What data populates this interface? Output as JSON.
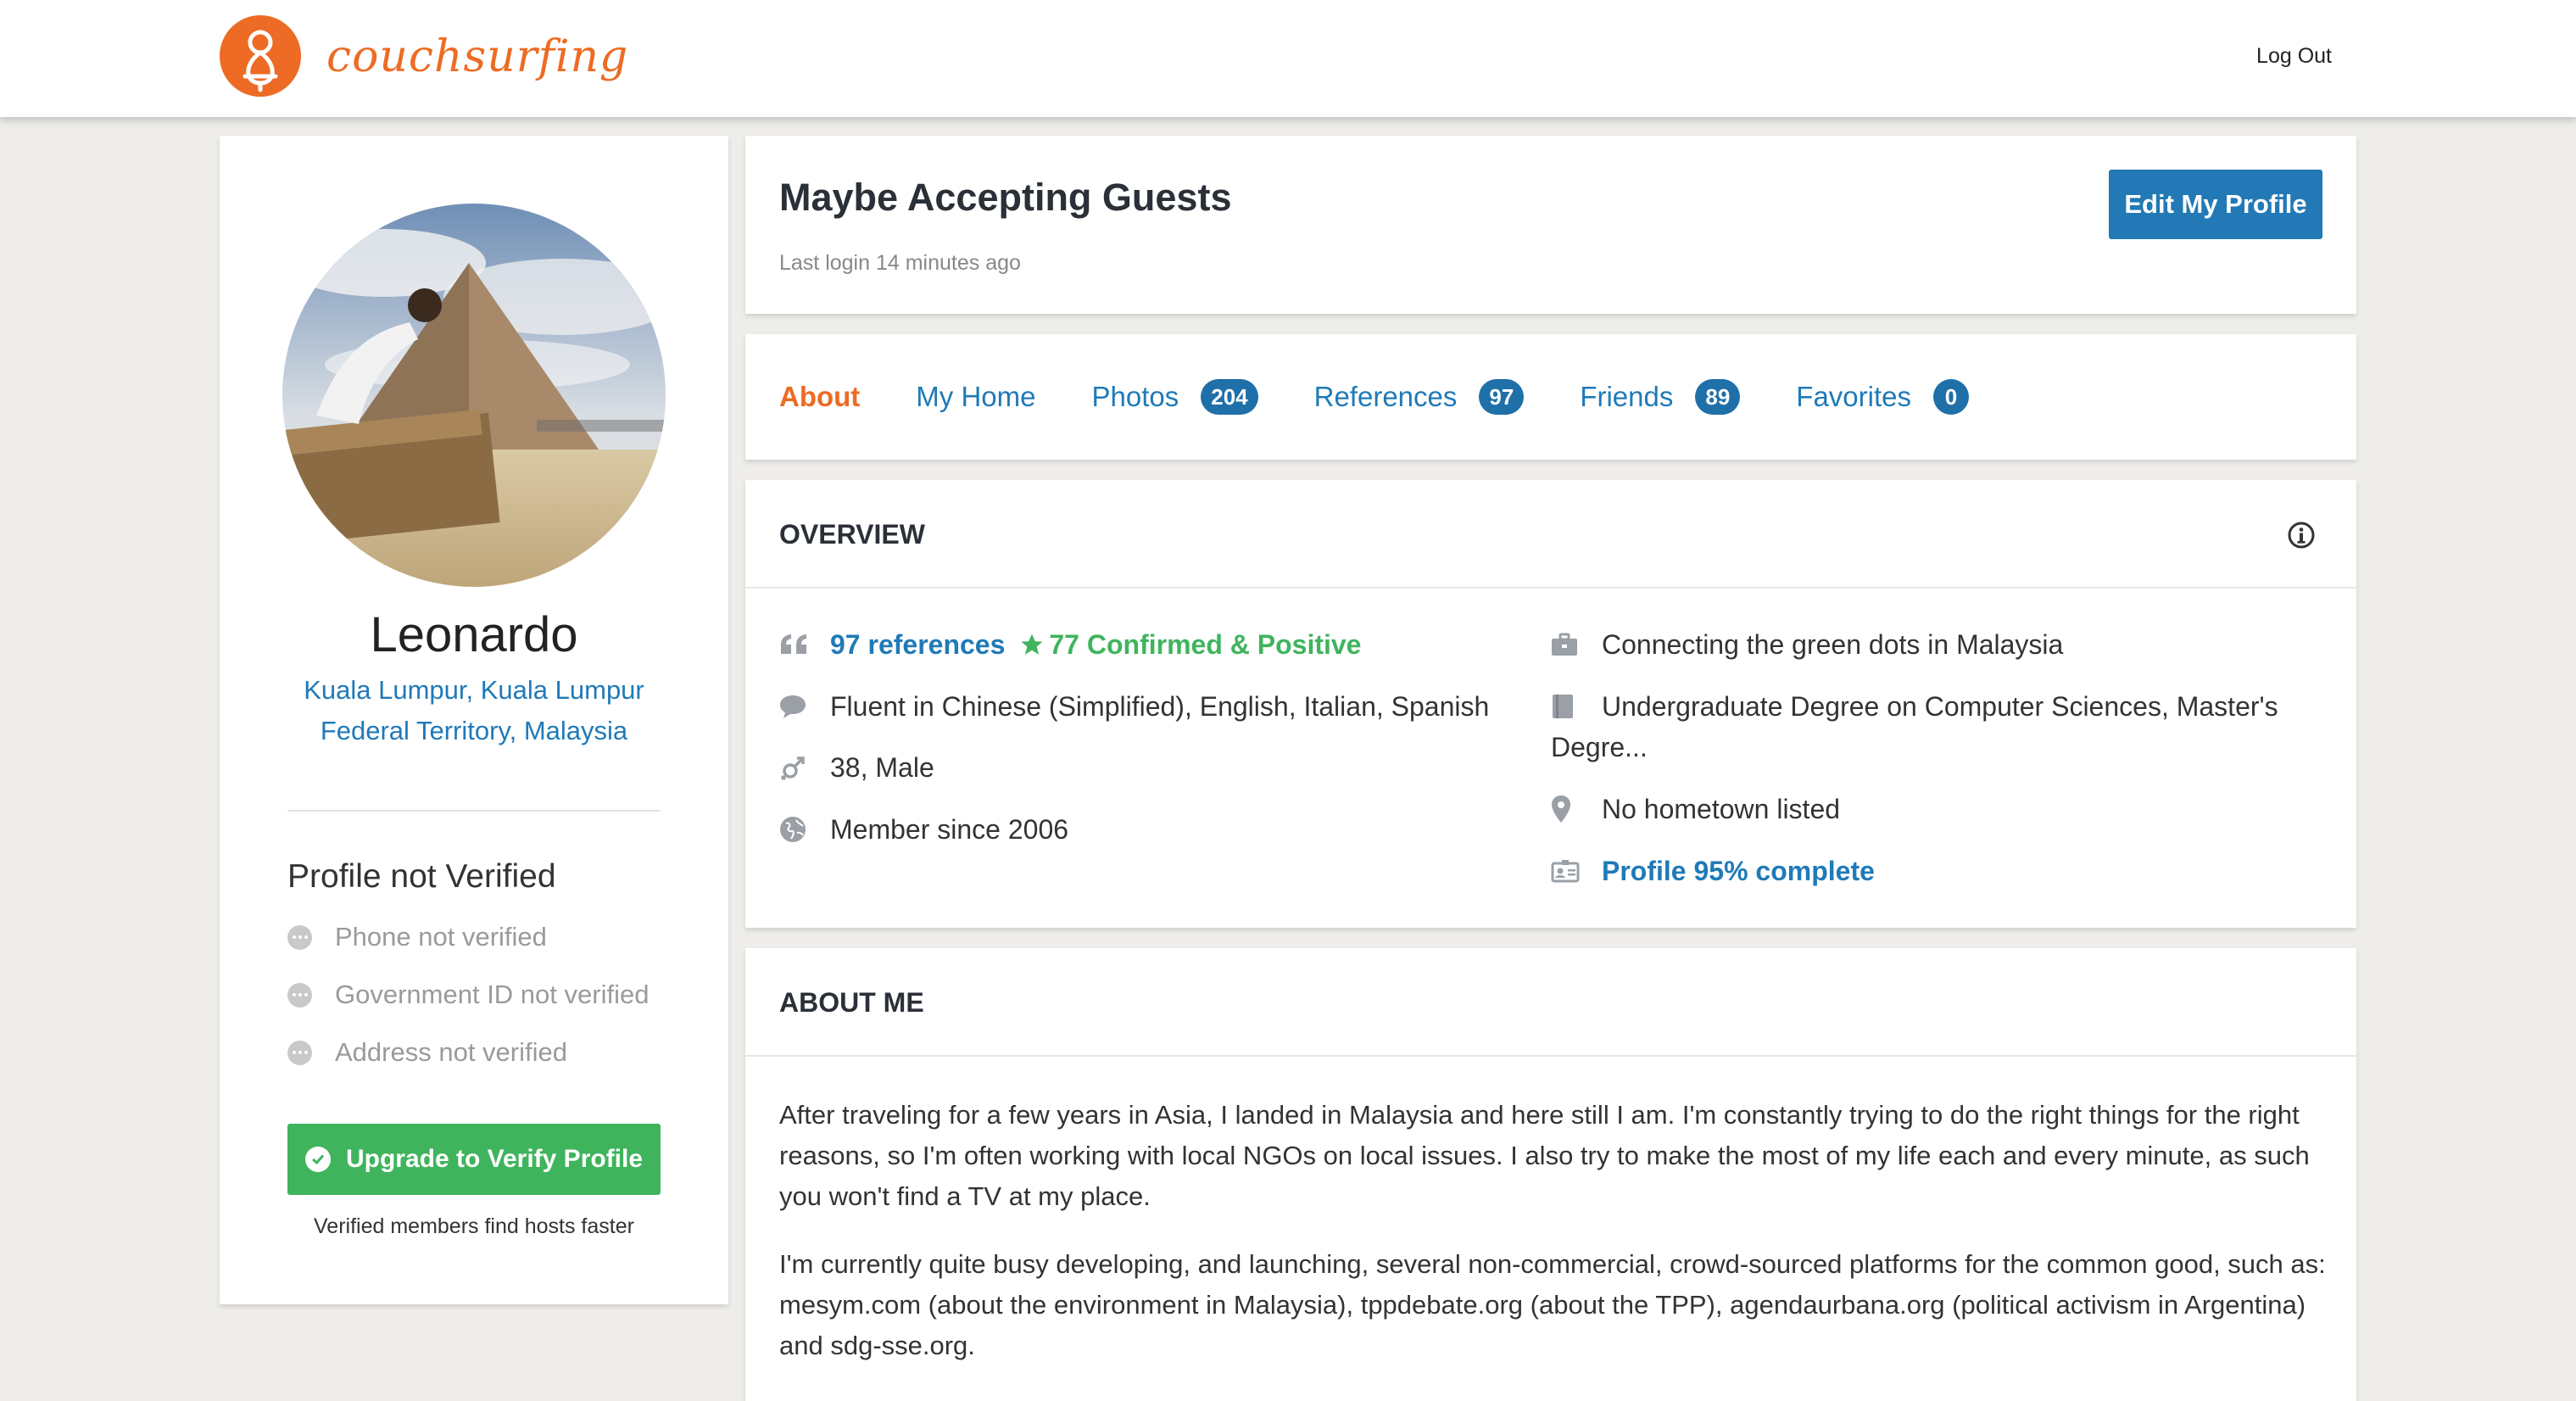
{
  "header": {
    "brand": "couchsurfing",
    "logout_label": "Log Out"
  },
  "profile": {
    "name": "Leonardo",
    "location_line1": "Kuala Lumpur, Kuala Lumpur",
    "location_line2": "Federal Territory, Malaysia"
  },
  "verification": {
    "title": "Profile not Verified",
    "items": [
      "Phone not verified",
      "Government ID not verified",
      "Address not verified"
    ],
    "upgrade_label": "Upgrade to Verify Profile",
    "note": "Verified members find hosts faster"
  },
  "status": {
    "title": "Maybe Accepting Guests",
    "last_login": "Last login 14 minutes ago",
    "edit_label": "Edit My Profile"
  },
  "tabs": [
    {
      "label": "About",
      "count": null
    },
    {
      "label": "My Home",
      "count": null
    },
    {
      "label": "Photos",
      "count": "204"
    },
    {
      "label": "References",
      "count": "97"
    },
    {
      "label": "Friends",
      "count": "89"
    },
    {
      "label": "Favorites",
      "count": "0"
    }
  ],
  "overview": {
    "title": "OVERVIEW",
    "references": "97 references",
    "confirmed": "77 Confirmed & Positive",
    "languages": "Fluent in Chinese (Simplified), English, Italian, Spanish",
    "age_gender": "38, Male",
    "member_since": "Member since 2006",
    "occupation": "Connecting the green dots in Malaysia",
    "education_line1": "Undergraduate Degree on Computer Sciences, Master's",
    "education_line2": "Degre...",
    "hometown": "No hometown listed",
    "completion": "Profile 95% complete"
  },
  "about": {
    "title": "ABOUT ME",
    "para1": "After traveling for a few years in Asia, I landed in Malaysia and here still I am. I'm constantly trying to do the right things for the right reasons, so I'm often working with local NGOs on local issues. I also try to make the most of my life each and every minute, as such you won't find a TV at my place.",
    "para2": "I'm currently quite busy developing, and launching, several non-commercial, crowd-sourced platforms for the common good, such as: mesym.com (about the environment in Malaysia), tppdebate.org (about the TPP), agendaurbana.org (political activism in Argentina) and sdg-sse.org."
  },
  "colors": {
    "brand_orange": "#ed6b24",
    "link_blue": "#1f7ab8",
    "button_blue": "#2279b5",
    "success_green": "#3fb45d",
    "badge_blue": "#1f6fa8",
    "page_bg": "#eeedea"
  },
  "icons": [
    "couchsurfing-logo",
    "info-icon",
    "quote-icon",
    "star-icon",
    "speech-bubble-icon",
    "gender-icon",
    "globe-icon",
    "briefcase-icon",
    "book-icon",
    "map-pin-icon",
    "id-card-icon",
    "check-circle-icon",
    "dots-icon"
  ]
}
